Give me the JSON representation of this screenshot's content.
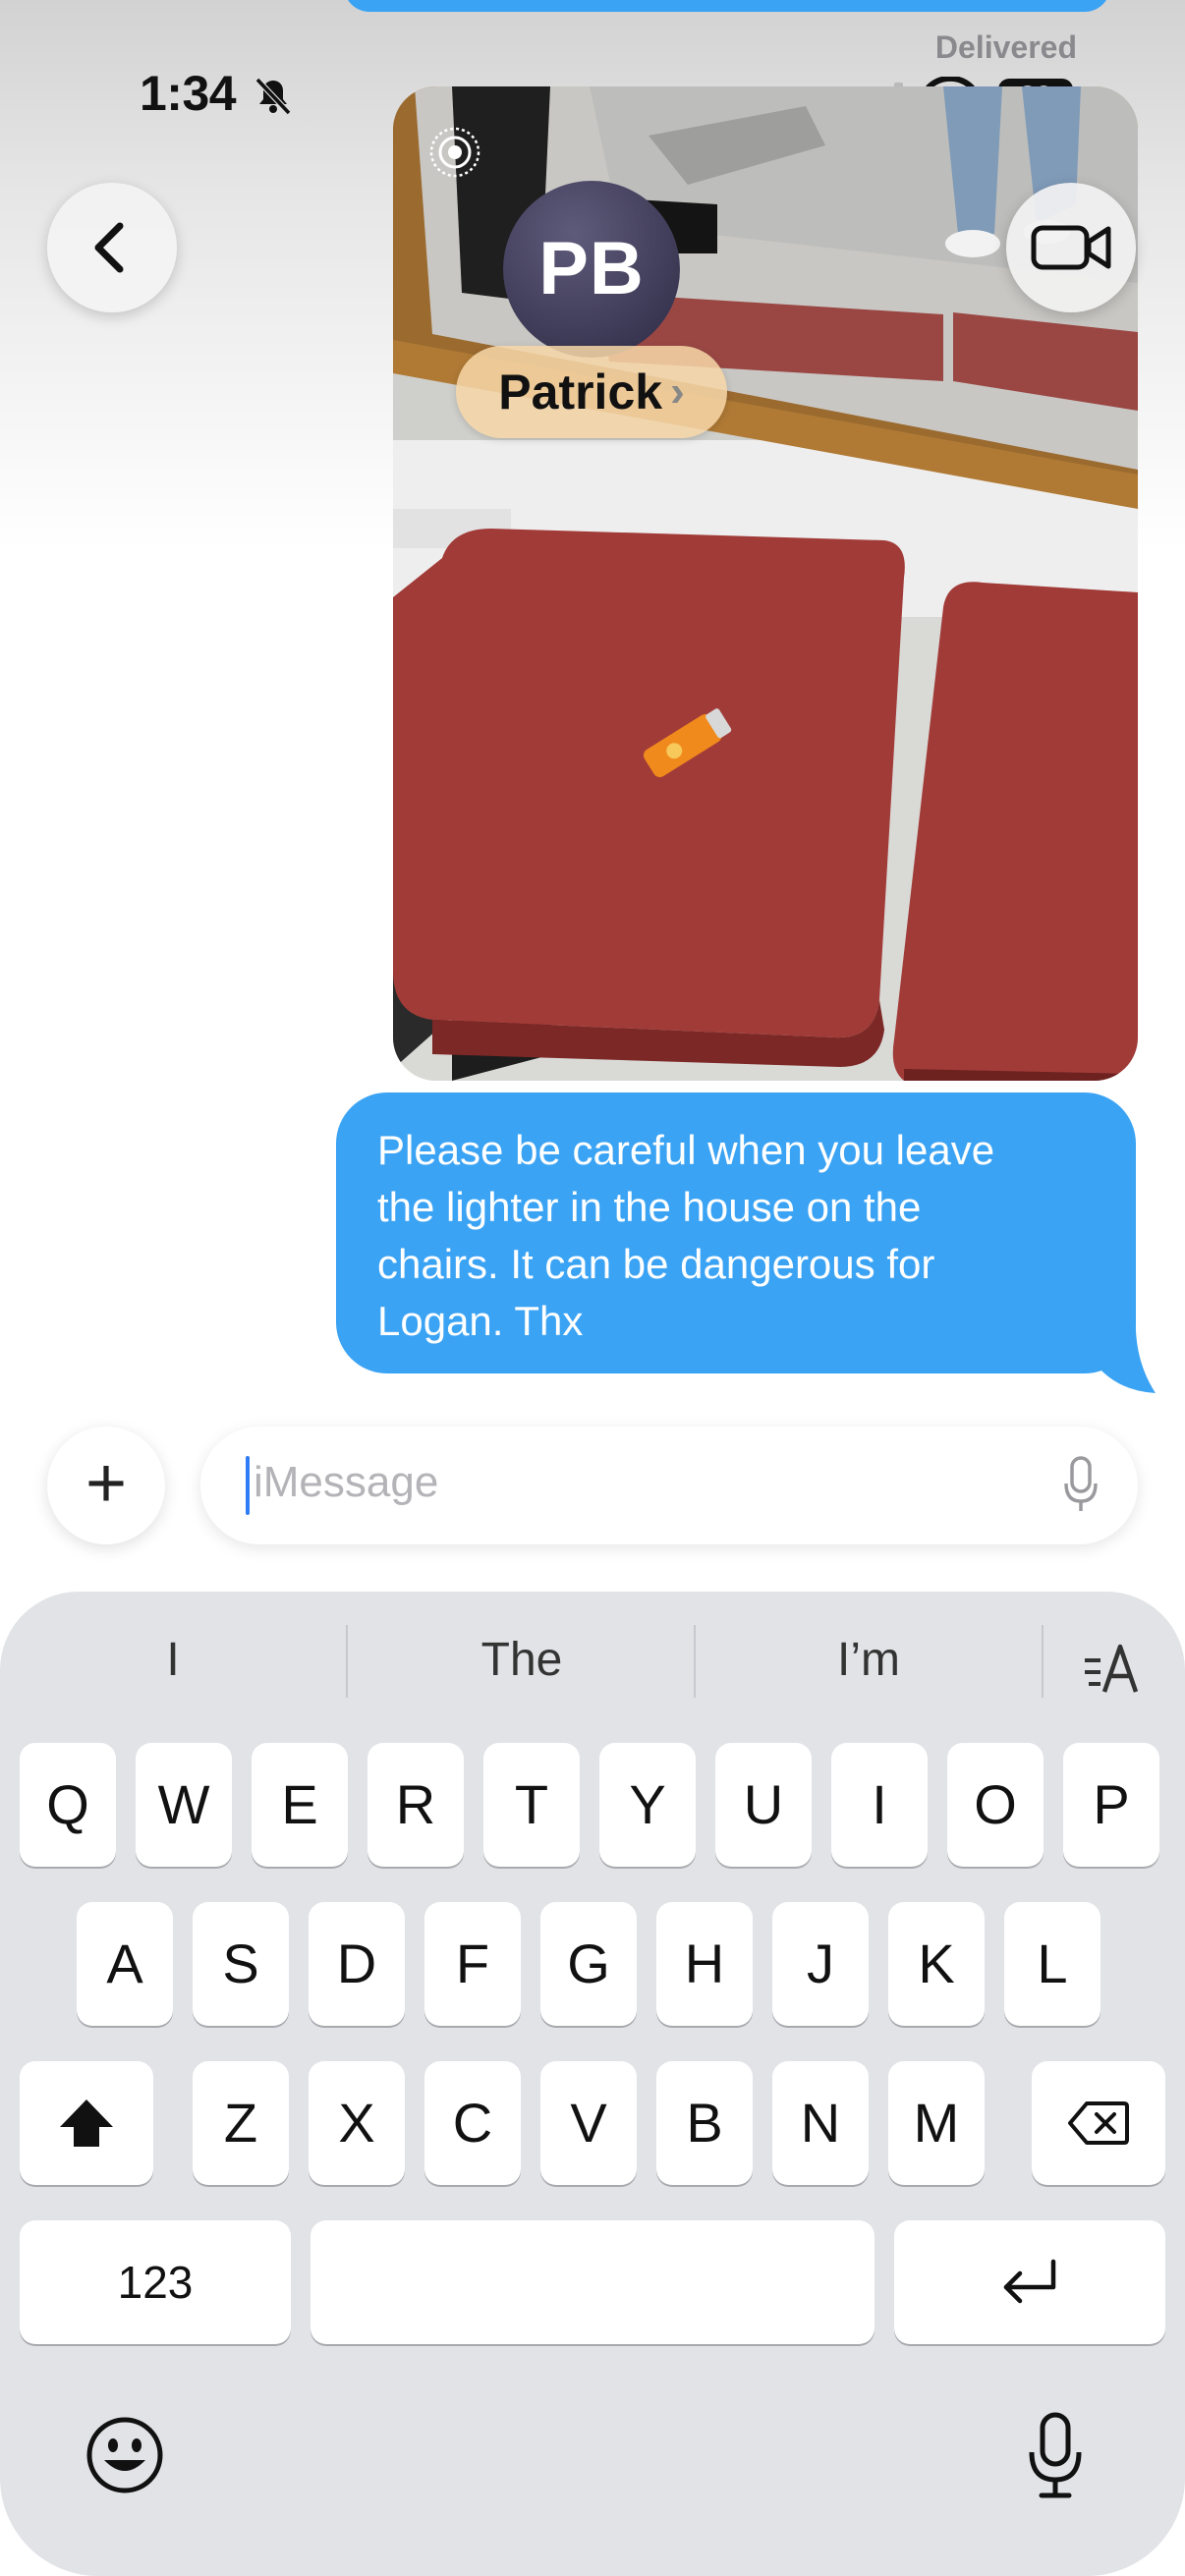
{
  "status_bar": {
    "time": "1:34",
    "battery": "83"
  },
  "message_status": "Delivered",
  "contact": {
    "initials": "PB",
    "name": "Patrick",
    "chevron": "›"
  },
  "messages": [
    {
      "text_lines": [
        "Please be careful when you leave",
        "the lighter in the house on the",
        "chairs. It can be dangerous for",
        "Logan. Thx"
      ]
    }
  ],
  "compose": {
    "plus": "+",
    "placeholder": "iMessage"
  },
  "keyboard": {
    "suggestions": [
      "I",
      "The",
      "I’m"
    ],
    "row1": [
      "Q",
      "W",
      "E",
      "R",
      "T",
      "Y",
      "U",
      "I",
      "O",
      "P"
    ],
    "row2": [
      "A",
      "S",
      "D",
      "F",
      "G",
      "H",
      "J",
      "K",
      "L"
    ],
    "row3": [
      "Z",
      "X",
      "C",
      "V",
      "B",
      "N",
      "M"
    ],
    "numbers_key": "123"
  },
  "icons": [
    "bell-slash-icon",
    "cellular-signal-icon",
    "wifi-icon",
    "battery-icon",
    "live-photo-icon",
    "back-chevron-icon",
    "video-camera-icon",
    "microphone-icon",
    "shift-icon",
    "delete-icon",
    "return-icon",
    "emoji-icon",
    "text-format-icon",
    "dictation-microphone-icon"
  ],
  "colors": {
    "bubble": "#3ba3f4",
    "caret": "#2f7cf6",
    "keyboard_bg": "#e2e3e7"
  }
}
